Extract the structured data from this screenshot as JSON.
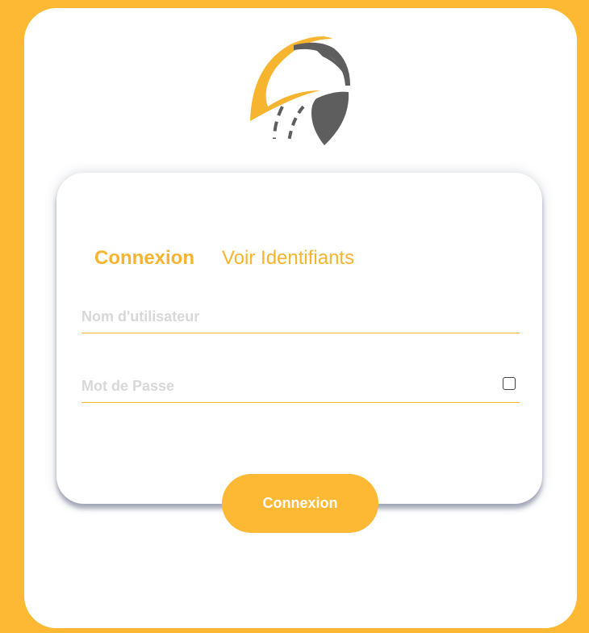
{
  "colors": {
    "background": "#FDB933",
    "accent": "#F6B42F",
    "logo_gray": "#5E5E5E"
  },
  "logo": {
    "icon": "road-shield-logo-icon"
  },
  "tabs": [
    {
      "label": "Connexion",
      "active": true
    },
    {
      "label": "Voir Identifiants",
      "active": false
    }
  ],
  "form": {
    "username": {
      "placeholder": "Nom d'utilisateur",
      "value": ""
    },
    "password": {
      "placeholder": "Mot de Passe",
      "value": ""
    },
    "show_password_checked": false
  },
  "submit": {
    "label": "Connexion"
  }
}
